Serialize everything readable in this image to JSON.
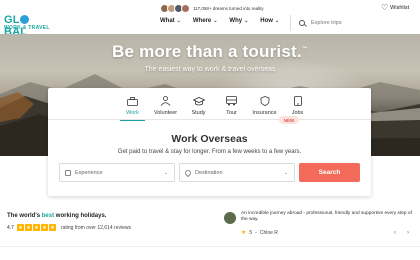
{
  "brand": {
    "line1": "GL",
    "line1b": "BAL",
    "line2": "WORK & TRAVEL"
  },
  "header": {
    "dreams_text": "117,058+ dreams turned into reality",
    "nav": [
      {
        "label": "What"
      },
      {
        "label": "Where"
      },
      {
        "label": "Why"
      },
      {
        "label": "How"
      }
    ],
    "search_placeholder": "Explore trips",
    "wishlist_label": "Wishlist"
  },
  "hero": {
    "title": "Be more than a tourist.",
    "trademark": "™",
    "subtitle": "The easiest way to work & travel overseas"
  },
  "card": {
    "tabs": [
      {
        "label": "Work",
        "icon": "briefcase-icon",
        "active": true
      },
      {
        "label": "Volunteer",
        "icon": "volunteer-icon",
        "active": false
      },
      {
        "label": "Study",
        "icon": "graduation-cap-icon",
        "active": false
      },
      {
        "label": "Tour",
        "icon": "bus-icon",
        "active": false
      },
      {
        "label": "Insurance",
        "icon": "shield-icon",
        "active": false
      },
      {
        "label": "Jobs",
        "icon": "phone-icon",
        "active": false
      }
    ],
    "new_badge": "NEW",
    "title": "Work Overseas",
    "subtitle": "Get paid to travel & stay for longer. From a few weeks to a few years.",
    "experience_placeholder": "Experience",
    "destination_placeholder": "Destination",
    "search_button": "Search"
  },
  "ratings": {
    "title_prefix": "The world's ",
    "title_highlight": "best",
    "title_suffix": " working holidays.",
    "score": "4.7",
    "stars": 5,
    "text": "rating from over 12,614 reviews"
  },
  "review": {
    "text": "An incredible journey abroad - professional, friendly and supportive every step of the way.",
    "score": "5",
    "author": "Chloe R",
    "prev": "‹",
    "next": "›"
  },
  "colors": {
    "accent": "#1aa3a0",
    "cta": "#f26b5b",
    "star": "#ffb400"
  }
}
